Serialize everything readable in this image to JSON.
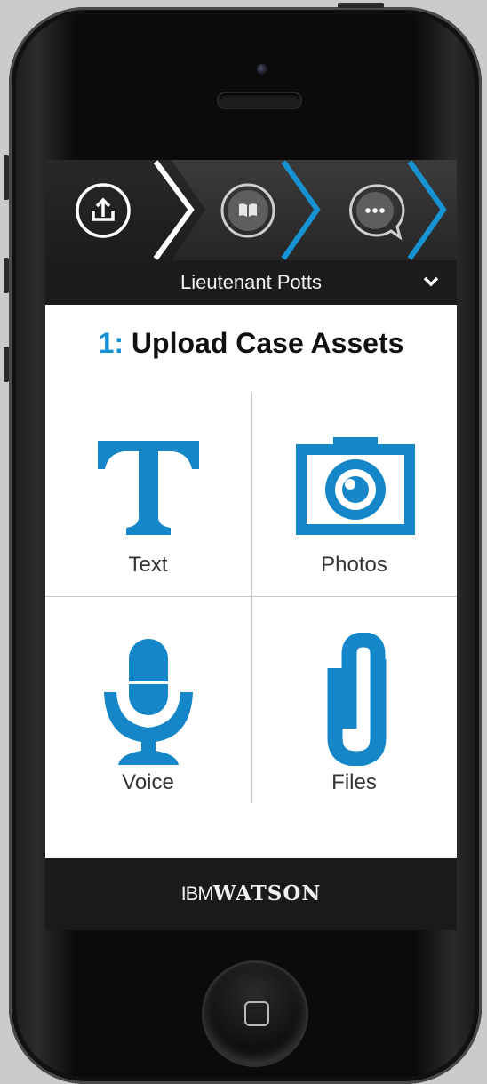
{
  "steps": [
    {
      "icon": "upload-icon",
      "state": "active"
    },
    {
      "icon": "book-icon",
      "state": "inactive"
    },
    {
      "icon": "chat-icon",
      "state": "inactive"
    }
  ],
  "user": {
    "name": "Lieutenant Potts",
    "menu_icon": "chevron-down-icon"
  },
  "page": {
    "step_number": "1:",
    "title": "Upload Case Assets"
  },
  "assets": [
    {
      "label": "Text",
      "icon": "text-icon"
    },
    {
      "label": "Photos",
      "icon": "camera-icon"
    },
    {
      "label": "Voice",
      "icon": "microphone-icon"
    },
    {
      "label": "Files",
      "icon": "paperclip-icon"
    }
  ],
  "footer": {
    "brand_prefix": "IBM",
    "brand_name": "WATSON"
  },
  "colors": {
    "accent": "#1793d3",
    "header_bg": "#262626",
    "footer_bg": "#1a1a1a"
  }
}
